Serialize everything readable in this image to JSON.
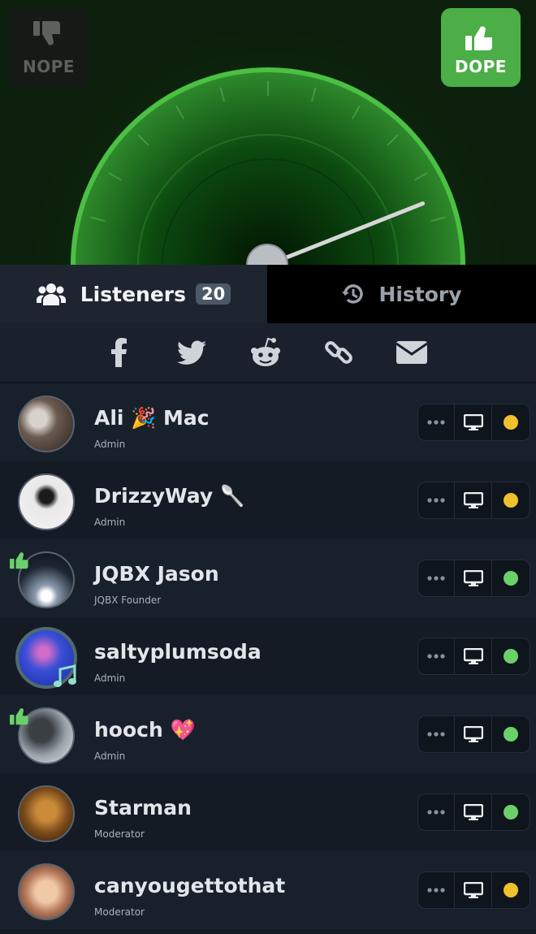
{
  "vote": {
    "nope_label": "NOPE",
    "dope_label": "DOPE"
  },
  "gauge": {
    "needle_level": 0.88,
    "accent": "#4bc043"
  },
  "tabs": {
    "listeners_label": "Listeners",
    "listeners_count": "20",
    "history_label": "History"
  },
  "share": [
    "facebook-icon",
    "twitter-icon",
    "reddit-icon",
    "link-icon",
    "email-icon"
  ],
  "listeners": [
    {
      "name": "Ali 🎉 Mac",
      "role": "Admin",
      "status": "yellow",
      "thumbs_up": false,
      "playing": false
    },
    {
      "name": "DrizzyWay 🥄",
      "role": "Admin",
      "status": "yellow",
      "thumbs_up": false,
      "playing": false
    },
    {
      "name": "JQBX Jason",
      "role": "JQBX Founder",
      "status": "green",
      "thumbs_up": true,
      "playing": false
    },
    {
      "name": "saltyplumsoda",
      "role": "Admin",
      "status": "green",
      "thumbs_up": false,
      "playing": true
    },
    {
      "name": "hooch 💖",
      "role": "Admin",
      "status": "green",
      "thumbs_up": true,
      "playing": false
    },
    {
      "name": "Starman",
      "role": "Moderator",
      "status": "green",
      "thumbs_up": false,
      "playing": false
    },
    {
      "name": "canyougettothat",
      "role": "Moderator",
      "status": "yellow",
      "thumbs_up": false,
      "playing": false
    }
  ],
  "colors": {
    "status_yellow": "#f0c12b",
    "status_green": "#6cd06a",
    "dope_green": "#4cae46"
  }
}
